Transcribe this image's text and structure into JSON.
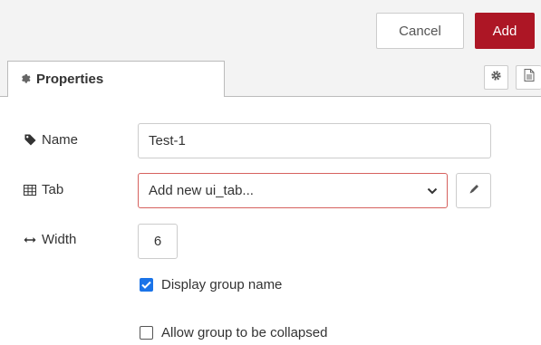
{
  "toolbar": {
    "cancel_label": "Cancel",
    "add_label": "Add",
    "add_color": "#ad1625"
  },
  "tabs": {
    "active_label": "Properties"
  },
  "form": {
    "name": {
      "label": "Name",
      "value": "Test-1"
    },
    "tab": {
      "label": "Tab",
      "selected": "Add new ui_tab..."
    },
    "width": {
      "label": "Width",
      "value": "6"
    },
    "display_group_name": {
      "label": "Display group name",
      "checked": true
    },
    "allow_collapse": {
      "label": "Allow group to be collapsed",
      "checked": false
    }
  },
  "icons": {
    "properties_tab": "gear-icon",
    "settings_button": "gear-icon",
    "description_button": "document-icon",
    "name": "tag-icon",
    "tab": "table-icon",
    "width": "arrows-horizontal-icon",
    "tab_edit": "pencil-icon",
    "select_chevron": "chevron-down-icon"
  }
}
